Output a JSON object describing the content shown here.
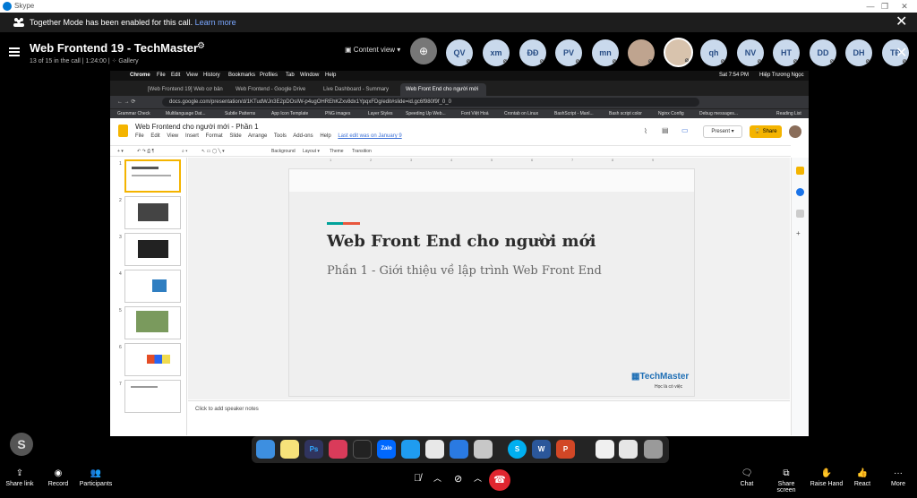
{
  "window": {
    "title": "Skype"
  },
  "notice": {
    "message": "Together Mode has been enabled for this call.",
    "learn_more": "Learn more"
  },
  "call": {
    "title": "Web Frontend 19 - TechMaster",
    "subtitle": "13 of 15 in the call | 1:24:00 | ⁘ Gallery",
    "content_view": "Content view",
    "participants": [
      "QV",
      "xm",
      "ĐĐ",
      "PV",
      "mn",
      "",
      "",
      "qh",
      "NV",
      "HT",
      "DD",
      "DH",
      "TĐ"
    ]
  },
  "mac": {
    "menu": [
      "Chrome",
      "File",
      "Edit",
      "View",
      "History",
      "Bookmarks",
      "Profiles",
      "Tab",
      "Window",
      "Help"
    ],
    "status": "Sat 7:54 PM",
    "user": "Hiệp Trương Ngọc",
    "tabs": [
      "[Web Frontend 19] Web cơ bản",
      "Web Frontend - Google Drive",
      "Live Dashboard - Summary",
      "Web Front End cho người mới"
    ],
    "url": "docs.google.com/presentation/d/1KTudWJn3E2pDOsIW-p4ugOHREhKZxv8dx1YpqxFDg/edit#slide=id.gc6f980f9f_0_0",
    "bookmarks": [
      "Grammar Check",
      "Multilanguage Dat...",
      "Subtle Patterns",
      "App Icon Template",
      "PNG images",
      "Layer Styles",
      "Speeding Up Web...",
      "Font Việt Hoá",
      "Crontab on Linux",
      "BashScript - Manl...",
      "Bash script color",
      "Nginx Config",
      "Debug messages...",
      "Reading List"
    ]
  },
  "slides": {
    "doc_title": "Web Frontend cho người mới - Phần 1",
    "menu": [
      "File",
      "Edit",
      "View",
      "Insert",
      "Format",
      "Slide",
      "Arrange",
      "Tools",
      "Add-ons",
      "Help"
    ],
    "last_edit": "Last edit was on January 9",
    "present": "Present",
    "share": "Share",
    "toolbar": [
      "Background",
      "Layout ▾",
      "Theme",
      "Transition"
    ],
    "ruler": [
      "1",
      "2",
      "3",
      "4",
      "5",
      "6",
      "7",
      "8",
      "9"
    ],
    "thumb_numbers": [
      "1",
      "2",
      "3",
      "4",
      "5",
      "6",
      "7"
    ],
    "slide_title": "Web Front End cho người mới",
    "slide_subtitle": "Phần 1 - Giới thiệu về lập trình Web Front End",
    "logo": "TechMaster",
    "logo_tag": "Học là có việc",
    "notes_placeholder": "Click to add speaker notes"
  },
  "bottom": {
    "share_link": "Share link",
    "record": "Record",
    "participants": "Participants",
    "chat": "Chat",
    "share_screen": "Share screen",
    "raise_hand": "Raise Hand",
    "react": "React",
    "more": "More"
  }
}
